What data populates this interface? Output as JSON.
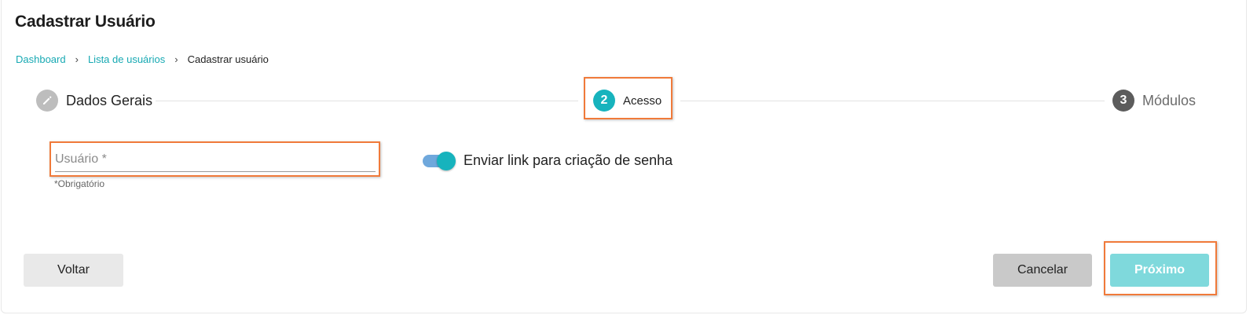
{
  "page": {
    "title": "Cadastrar Usuário"
  },
  "breadcrumb": {
    "items": [
      "Dashboard",
      "Lista de usuários",
      "Cadastrar usuário"
    ],
    "separator": "›"
  },
  "stepper": {
    "steps": [
      {
        "number": "",
        "label": "Dados Gerais",
        "state": "completed",
        "icon": "pencil-icon"
      },
      {
        "number": "2",
        "label": "Acesso",
        "state": "active"
      },
      {
        "number": "3",
        "label": "Módulos",
        "state": "pending"
      }
    ]
  },
  "form": {
    "user_field": {
      "placeholder": "Usuário *",
      "value": ""
    },
    "required_note": "*Obrigatório",
    "send_link_toggle": {
      "label": "Enviar link para criação de senha",
      "on": true
    }
  },
  "actions": {
    "back_label": "Voltar",
    "cancel_label": "Cancelar",
    "next_label": "Próximo"
  },
  "colors": {
    "accent": "#17b3bd",
    "link": "#17a9b3",
    "highlight_border": "#f07a3a",
    "next_button": "#7fd9dc"
  }
}
